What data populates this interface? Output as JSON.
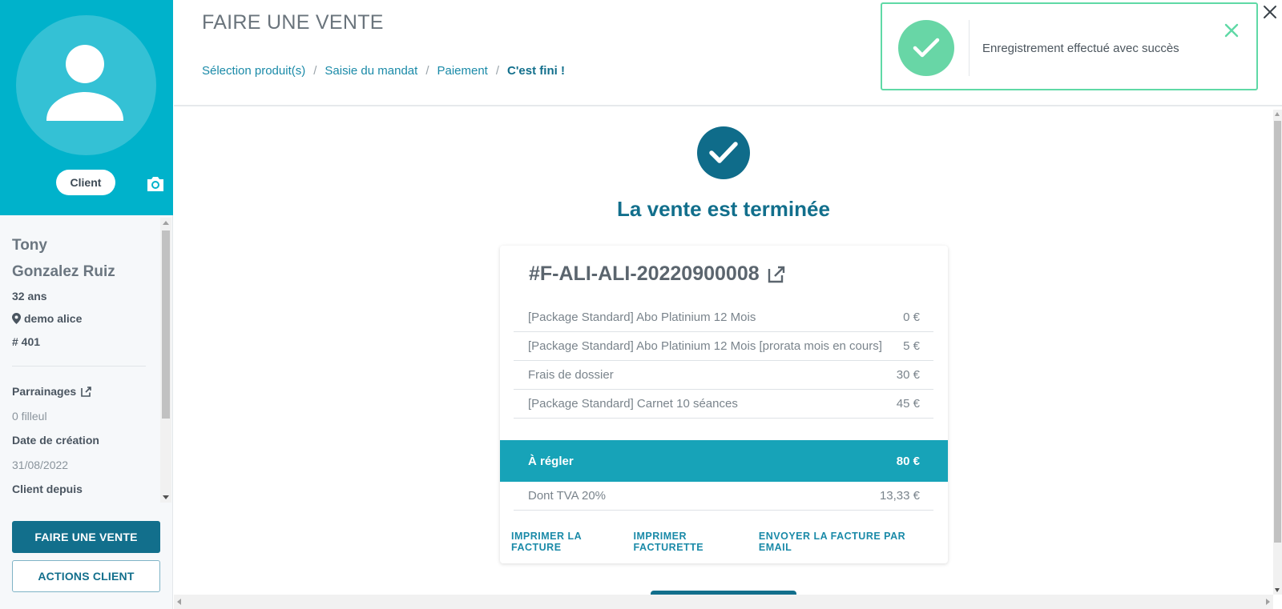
{
  "sidebar": {
    "badge": "Client",
    "first_name": "Tony",
    "last_name": "Gonzalez Ruiz",
    "age": "32 ans",
    "location": "demo alice",
    "client_id": "# 401",
    "referrals_label": "Parrainages",
    "referrals_value": "0 filleul",
    "created_label": "Date de création",
    "created_value": "31/08/2022",
    "since_label": "Client depuis",
    "sell_button": "FAIRE UNE VENTE",
    "actions_button": "ACTIONS CLIENT"
  },
  "header": {
    "title": "FAIRE UNE VENTE",
    "breadcrumb": [
      "Sélection produit(s)",
      "Saisie du mandat",
      "Paiement",
      "C'est fini !"
    ],
    "separator": "/"
  },
  "toast": {
    "message": "Enregistrement effectué avec succès"
  },
  "success": {
    "title": "La vente est terminée"
  },
  "invoice": {
    "number": "#F-ALI-ALI-20220900008",
    "lines": [
      {
        "label": "[Package Standard] Abo Platinium 12 Mois",
        "amount": "0 €"
      },
      {
        "label": "[Package Standard] Abo Platinium 12 Mois [prorata mois en cours]",
        "amount": "5 €"
      },
      {
        "label": "Frais de dossier",
        "amount": "30 €"
      },
      {
        "label": "[Package Standard] Carnet 10 séances",
        "amount": "45 €"
      }
    ],
    "total_label": "À régler",
    "total_value": "80 €",
    "tva_label": "Dont TVA 20%",
    "tva_value": "13,33 €",
    "actions": [
      "IMPRIMER LA FACTURE",
      "IMPRIMER FACTURETTE",
      "ENVOYER LA FACTURE PAR EMAIL"
    ]
  },
  "colors": {
    "sidebar_header": "#00b2cb",
    "primary": "#126f8c",
    "total_bar": "#17a3b8",
    "toast_success": "#68d6a6"
  },
  "icons": {
    "avatar": "person-icon",
    "camera": "camera-icon",
    "location": "map-pin-icon",
    "external": "external-link-icon",
    "success": "check-icon",
    "close": "close-icon"
  }
}
